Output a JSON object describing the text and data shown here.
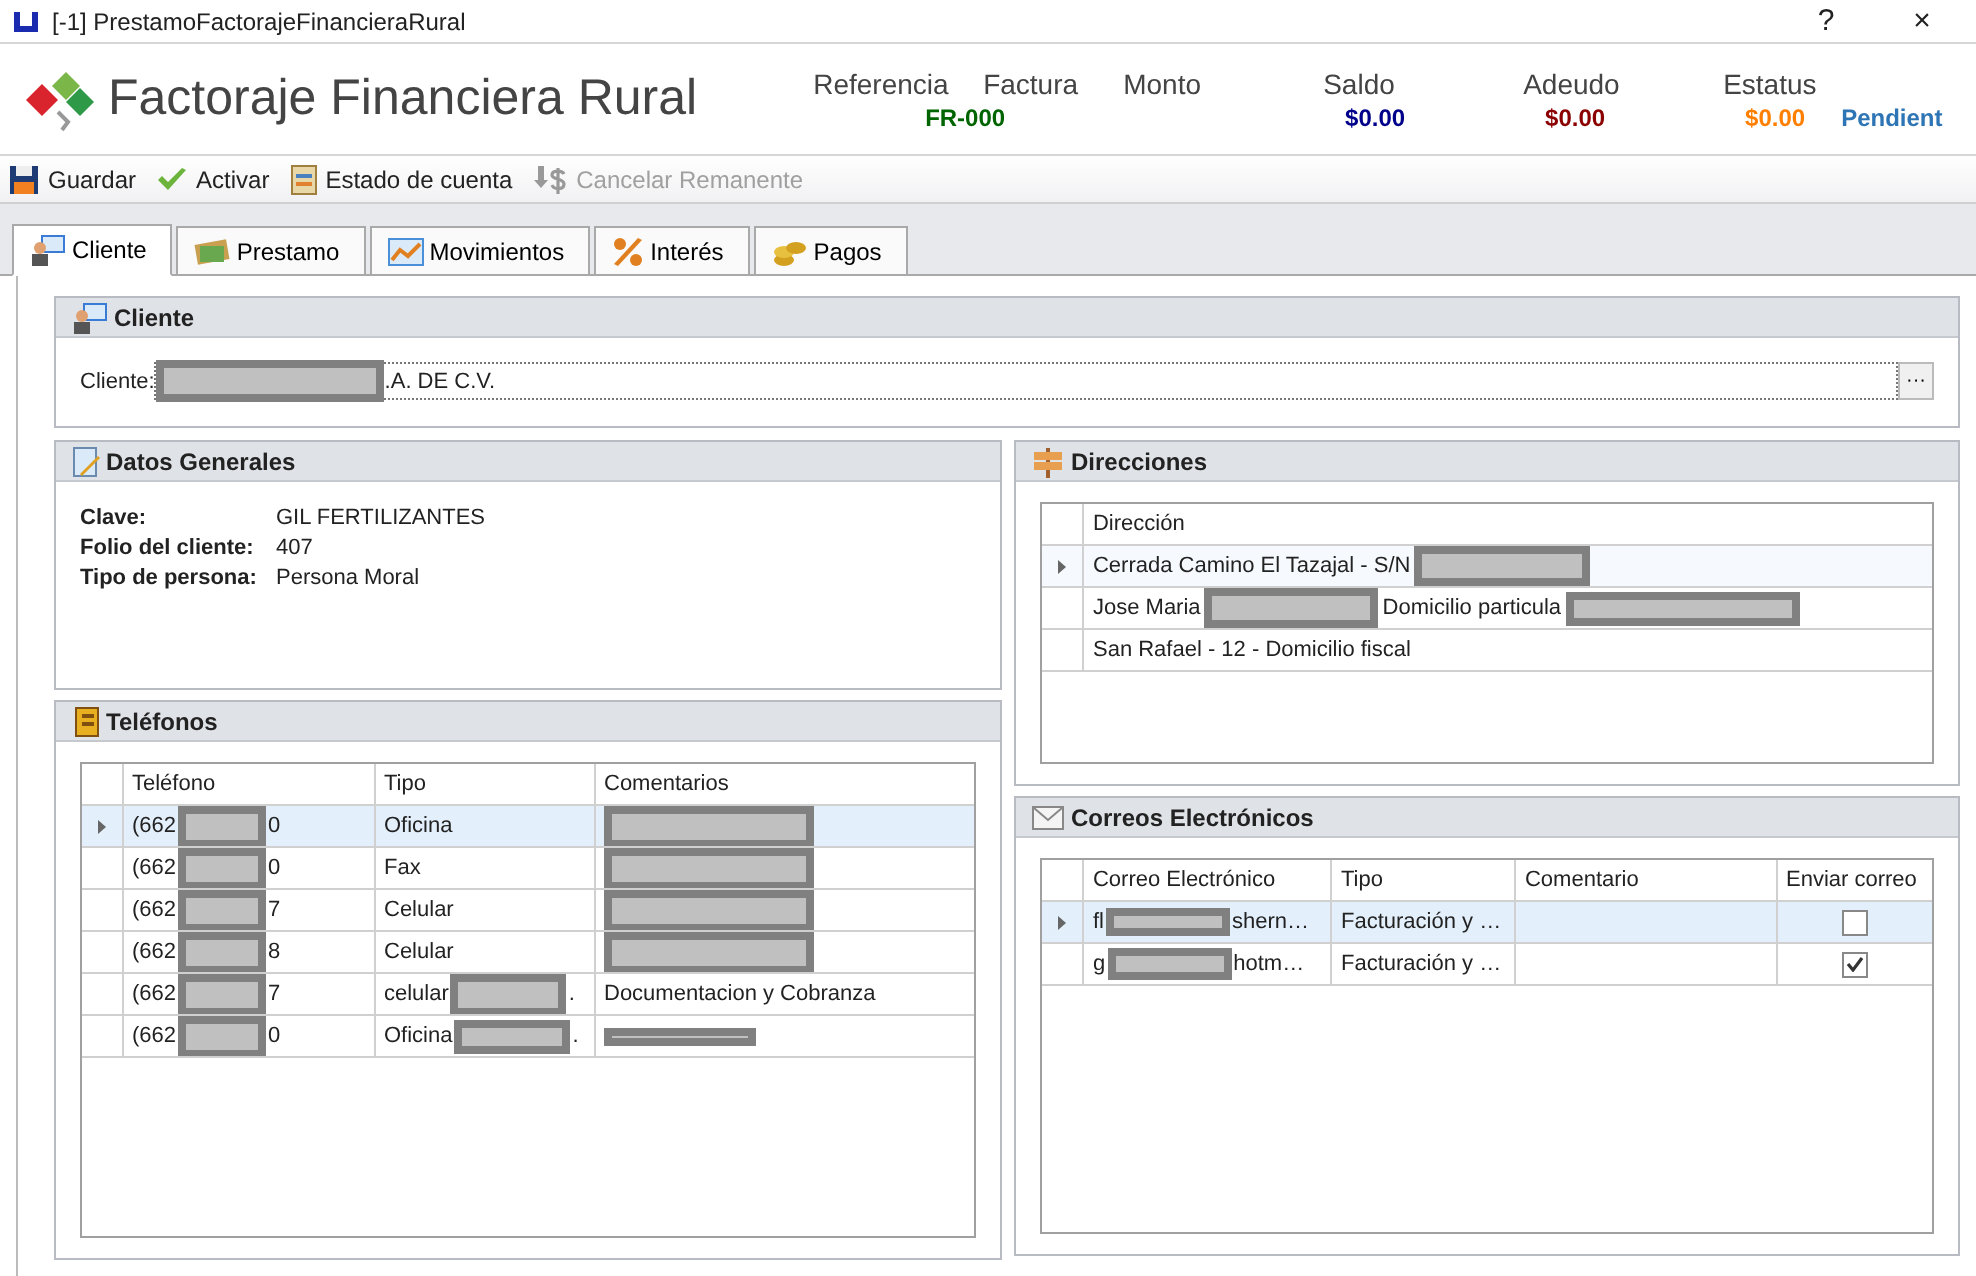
{
  "window": {
    "title": "[-1] PrestamoFactorajeFinancieraRural",
    "help": "?",
    "close": "×"
  },
  "header": {
    "app_name": "Factoraje Financiera Rural",
    "labels": [
      "Referencia",
      "Factura",
      "Monto",
      "Saldo",
      "Adeudo",
      "Estatus"
    ],
    "values": [
      {
        "text": "FR-000",
        "color": "#006400"
      },
      {
        "text": "$0.00",
        "color": "#00008b"
      },
      {
        "text": "$0.00",
        "color": "#8b0000"
      },
      {
        "text": "$0.00",
        "color": "#ff7f00"
      },
      {
        "text": "Pendient",
        "color": "#2e75b6"
      }
    ]
  },
  "toolbar": [
    {
      "kind": "save",
      "label": "Guardar",
      "disabled": false
    },
    {
      "kind": "activate",
      "label": "Activar",
      "disabled": false
    },
    {
      "kind": "statement",
      "label": "Estado de cuenta",
      "disabled": false
    },
    {
      "kind": "cancel",
      "label": "Cancelar Remanente",
      "disabled": true
    }
  ],
  "tabs": [
    {
      "kind": "client",
      "label": "Cliente",
      "selected": true
    },
    {
      "kind": "loan",
      "label": "Prestamo",
      "selected": false
    },
    {
      "kind": "moves",
      "label": "Movimientos",
      "selected": false
    },
    {
      "kind": "interest",
      "label": "Interés",
      "selected": false
    },
    {
      "kind": "payments",
      "label": "Pagos",
      "selected": false
    }
  ],
  "cliente": {
    "title": "Cliente",
    "label": "Cliente:",
    "value_tail": ".A. DE C.V.",
    "button": "···"
  },
  "datos_generales": {
    "title": "Datos Generales",
    "fields": [
      {
        "label": "Clave:",
        "value": "GIL FERTILIZANTES"
      },
      {
        "label": "Folio del cliente:",
        "value": "407"
      },
      {
        "label": "Tipo de persona:",
        "value": "Persona Moral"
      }
    ]
  },
  "direcciones": {
    "title": "Direcciones",
    "columns": [
      "Dirección"
    ],
    "rows": [
      {
        "selected": true,
        "cells": [
          "Cerrada Camino El Tazajal - S/N"
        ]
      },
      {
        "selected": false,
        "cells": [
          "Jose Maria",
          "Domicilio particula"
        ]
      },
      {
        "selected": false,
        "cells": [
          "San Rafael  - 12 - Domicilio fiscal"
        ]
      }
    ]
  },
  "telefonos": {
    "title": "Teléfonos",
    "columns": [
      "Teléfono",
      "Tipo",
      "Comentarios"
    ],
    "rows": [
      {
        "selected": true,
        "phone": [
          "(662",
          "0"
        ],
        "tipo": "Oficina",
        "comentarios": ""
      },
      {
        "selected": false,
        "phone": [
          "(662",
          "0"
        ],
        "tipo": "Fax",
        "comentarios": ""
      },
      {
        "selected": false,
        "phone": [
          "(662",
          "7"
        ],
        "tipo": "Celular",
        "comentarios": ""
      },
      {
        "selected": false,
        "phone": [
          "(662",
          "8"
        ],
        "tipo": "Celular",
        "comentarios": ""
      },
      {
        "selected": false,
        "phone": [
          "(662",
          "7"
        ],
        "tipo": "celular",
        "tipo_tail": ".",
        "comentarios": "Documentacion y Cobranza"
      },
      {
        "selected": false,
        "phone": [
          "(662",
          "0"
        ],
        "tipo": "Oficina",
        "tipo_tail": ".",
        "comentarios": ""
      }
    ]
  },
  "correos": {
    "title": "Correos Electrónicos",
    "columns": [
      "Correo Electrónico",
      "Tipo",
      "Comentario",
      "Enviar correo"
    ],
    "rows": [
      {
        "selected": true,
        "email": [
          "fl",
          "shern…"
        ],
        "tipo": "Facturación y …",
        "checked": false
      },
      {
        "selected": false,
        "email": [
          "g",
          "hotm…"
        ],
        "tipo": "Facturación y …",
        "checked": true
      }
    ]
  }
}
